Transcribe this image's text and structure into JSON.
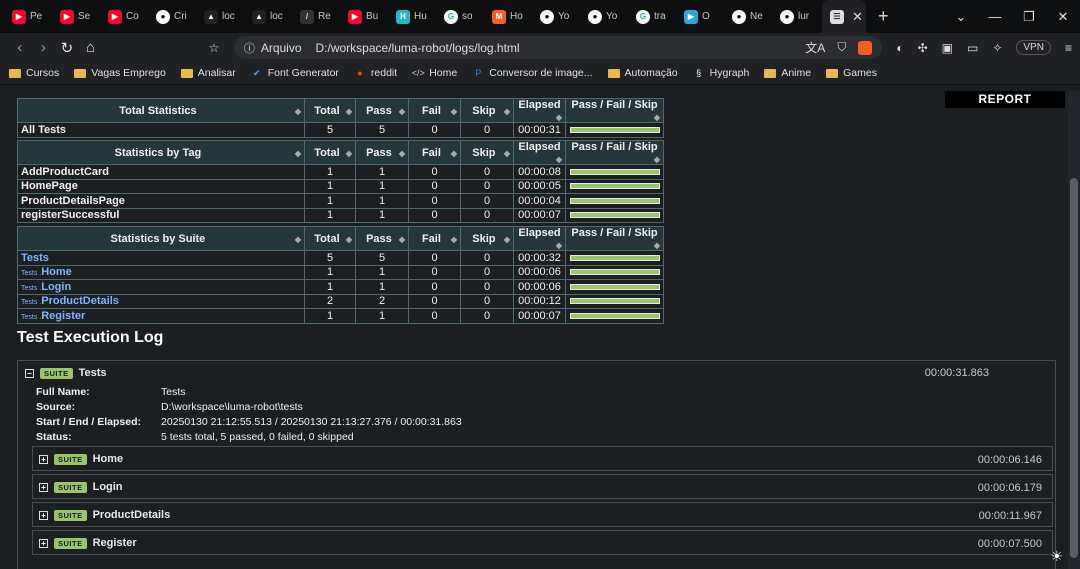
{
  "browser": {
    "tabs": [
      {
        "icon": "youtube-icon",
        "cls": "yt",
        "glyph": "▶",
        "label": "Pe"
      },
      {
        "icon": "youtube-icon",
        "cls": "yt",
        "glyph": "▶",
        "label": "Se"
      },
      {
        "icon": "youtube-icon",
        "cls": "yt",
        "glyph": "▶",
        "label": "Co"
      },
      {
        "icon": "github-icon",
        "cls": "gh",
        "glyph": "●",
        "label": "Cri"
      },
      {
        "icon": "triangle-icon",
        "cls": "tri",
        "glyph": "▲",
        "label": "loc"
      },
      {
        "icon": "triangle-icon",
        "cls": "tri",
        "glyph": "▲",
        "label": "loc"
      },
      {
        "icon": "release-icon",
        "cls": "re",
        "glyph": "/",
        "label": "Re"
      },
      {
        "icon": "youtube-icon",
        "cls": "yt",
        "glyph": "▶",
        "label": "Bu"
      },
      {
        "icon": "hu-icon",
        "cls": "hu",
        "glyph": "H",
        "label": "Hu"
      },
      {
        "icon": "google-icon",
        "cls": "g",
        "glyph": "G",
        "label": "so"
      },
      {
        "icon": "magento-icon",
        "cls": "mg",
        "glyph": "M",
        "label": "Ho"
      },
      {
        "icon": "github-icon",
        "cls": "gh",
        "glyph": "●",
        "label": "Yo"
      },
      {
        "icon": "github-icon",
        "cls": "gh",
        "glyph": "●",
        "label": "Yo"
      },
      {
        "icon": "google-icon",
        "cls": "g",
        "glyph": "G",
        "label": "tra"
      },
      {
        "icon": "video-icon",
        "cls": "vid",
        "glyph": "▶",
        "label": "O"
      },
      {
        "icon": "github-icon",
        "cls": "gh",
        "glyph": "●",
        "label": "Ne"
      },
      {
        "icon": "github-icon",
        "cls": "gh",
        "glyph": "●",
        "label": "lur"
      }
    ],
    "active_tab_close": "✕",
    "new_tab": "+",
    "window_controls": [
      "⌄",
      "—",
      "❐",
      "✕"
    ],
    "nav": {
      "back": "‹",
      "forward": "›",
      "reload": "↻",
      "home": "⌂",
      "bookmark": "🔖"
    },
    "omnibox_label": "Arquivo",
    "url": "D:/workspace/luma-robot/logs/log.html",
    "vpn": "VPN",
    "bookmarks": [
      {
        "label": "Cursos",
        "icon": "folder"
      },
      {
        "label": "Vagas Emprego",
        "icon": "folder"
      },
      {
        "label": "Analisar",
        "icon": "folder"
      },
      {
        "label": "Font Generator",
        "icon": "check"
      },
      {
        "label": "reddit",
        "icon": "reddit"
      },
      {
        "label": "Home",
        "icon": "code"
      },
      {
        "label": "Conversor de image...",
        "icon": "pdf"
      },
      {
        "label": "Automação",
        "icon": "folder"
      },
      {
        "label": "Hygraph",
        "icon": "hygraph"
      },
      {
        "label": "Anime",
        "icon": "folder"
      },
      {
        "label": "Games",
        "icon": "folder"
      }
    ]
  },
  "report": {
    "report_button": "REPORT",
    "columns": [
      "Total",
      "Pass",
      "Fail",
      "Skip",
      "Elapsed",
      "Pass / Fail / Skip"
    ],
    "total_stats": {
      "title": "Total Statistics",
      "rows": [
        {
          "name": "All Tests",
          "total": "5",
          "pass": "5",
          "fail": "0",
          "skip": "0",
          "elapsed": "00:00:31"
        }
      ]
    },
    "tag_stats": {
      "title": "Statistics by Tag",
      "rows": [
        {
          "name": "AddProductCard",
          "total": "1",
          "pass": "1",
          "fail": "0",
          "skip": "0",
          "elapsed": "00:00:08"
        },
        {
          "name": "HomePage",
          "total": "1",
          "pass": "1",
          "fail": "0",
          "skip": "0",
          "elapsed": "00:00:05"
        },
        {
          "name": "ProductDetailsPage",
          "total": "1",
          "pass": "1",
          "fail": "0",
          "skip": "0",
          "elapsed": "00:00:04"
        },
        {
          "name": "registerSuccessful",
          "total": "1",
          "pass": "1",
          "fail": "0",
          "skip": "0",
          "elapsed": "00:00:07"
        }
      ]
    },
    "suite_stats": {
      "title": "Statistics by Suite",
      "rows": [
        {
          "prefix": "",
          "name": "Tests",
          "total": "5",
          "pass": "5",
          "fail": "0",
          "skip": "0",
          "elapsed": "00:00:32"
        },
        {
          "prefix": "Tests .",
          "name": "Home",
          "total": "1",
          "pass": "1",
          "fail": "0",
          "skip": "0",
          "elapsed": "00:00:06"
        },
        {
          "prefix": "Tests .",
          "name": "Login",
          "total": "1",
          "pass": "1",
          "fail": "0",
          "skip": "0",
          "elapsed": "00:00:06"
        },
        {
          "prefix": "Tests .",
          "name": "ProductDetails",
          "total": "2",
          "pass": "2",
          "fail": "0",
          "skip": "0",
          "elapsed": "00:00:12"
        },
        {
          "prefix": "Tests .",
          "name": "Register",
          "total": "1",
          "pass": "1",
          "fail": "0",
          "skip": "0",
          "elapsed": "00:00:07"
        }
      ]
    },
    "log_title": "Test Execution Log",
    "suite": {
      "badge": "SUITE",
      "toggle": "−",
      "name": "Tests",
      "time": "00:00:31.863",
      "meta": [
        {
          "key": "Full Name:",
          "value": "Tests",
          "link": false
        },
        {
          "key": "Source:",
          "value": "D:\\workspace\\luma-robot\\tests",
          "link": true
        },
        {
          "key": "Start / End / Elapsed:",
          "value": "20250130 21:12:55.513 / 20250130 21:13:27.376 / 00:00:31.863",
          "link": false
        },
        {
          "key": "Status:",
          "value": "5 tests total, 5 passed, 0 failed, 0 skipped",
          "link": false
        }
      ],
      "children": [
        {
          "toggle": "+",
          "name": "Home",
          "time": "00:00:06.146"
        },
        {
          "toggle": "+",
          "name": "Login",
          "time": "00:00:06.179"
        },
        {
          "toggle": "+",
          "name": "ProductDetails",
          "time": "00:00:11.967"
        },
        {
          "toggle": "+",
          "name": "Register",
          "time": "00:00:07.500"
        }
      ]
    },
    "colors": {
      "pass_bar": "#98c46a",
      "header_bg": "#24373a",
      "link": "#7fb5ff"
    }
  }
}
